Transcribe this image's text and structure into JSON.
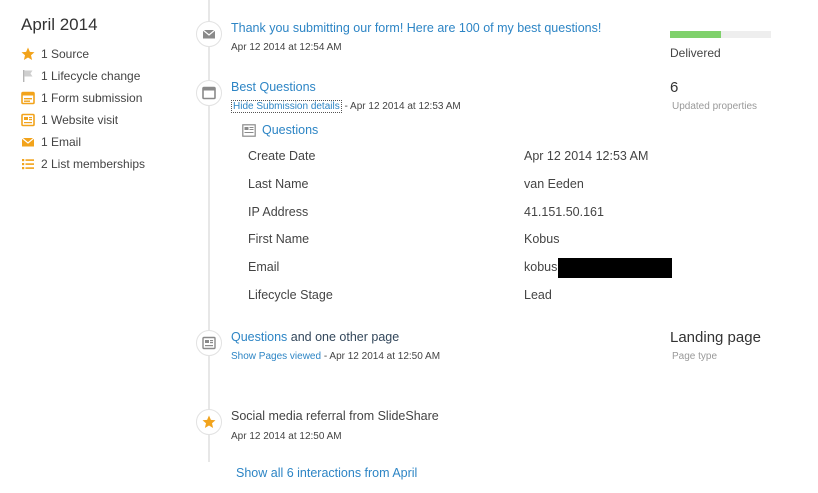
{
  "sidebar": {
    "month": "April 2014",
    "items": [
      {
        "icon": "star-icon",
        "label": "1 Source"
      },
      {
        "icon": "flag-icon",
        "label": "1 Lifecycle change"
      },
      {
        "icon": "form-icon",
        "label": "1 Form submission"
      },
      {
        "icon": "page-icon",
        "label": "1 Website visit"
      },
      {
        "icon": "email-icon",
        "label": "1 Email"
      },
      {
        "icon": "list-icon",
        "label": "2 List memberships"
      }
    ]
  },
  "events": {
    "email": {
      "title": "Thank you submitting our form! Here are 100 of my best questions!",
      "timestamp": "Apr 12 2014 at 12:54 AM",
      "status": "Delivered",
      "progress": 0.5
    },
    "form": {
      "title": "Best Questions",
      "toggle_label": "Hide Submission details",
      "timestamp": " - Apr 12 2014 at 12:53 AM",
      "updated_count": "6",
      "updated_label": "Updated properties",
      "form_name": "Questions",
      "fields": [
        {
          "key": "Create Date",
          "value": "Apr 12 2014 12:53 AM"
        },
        {
          "key": "Last Name",
          "value": "van Eeden"
        },
        {
          "key": "IP Address",
          "value": "41.151.50.161"
        },
        {
          "key": "First Name",
          "value": "Kobus"
        },
        {
          "key": "Email",
          "value": "kobus"
        },
        {
          "key": "Lifecycle Stage",
          "value": "Lead"
        }
      ]
    },
    "visit": {
      "title_link": "Questions",
      "title_rest": " and one other page",
      "toggle_label": "Show Pages viewed",
      "timestamp": " - Apr 12 2014 at 12:50 AM",
      "page_type_value": "Landing page",
      "page_type_label": "Page type"
    },
    "source": {
      "title": "Social media referral from SlideShare",
      "timestamp": "Apr 12 2014 at 12:50 AM"
    }
  },
  "show_all": "Show all 6 interactions from April",
  "colors": {
    "accent_orange": "#f2a31b",
    "link_blue": "#2d85c5",
    "progress_green": "#7fd16b"
  }
}
